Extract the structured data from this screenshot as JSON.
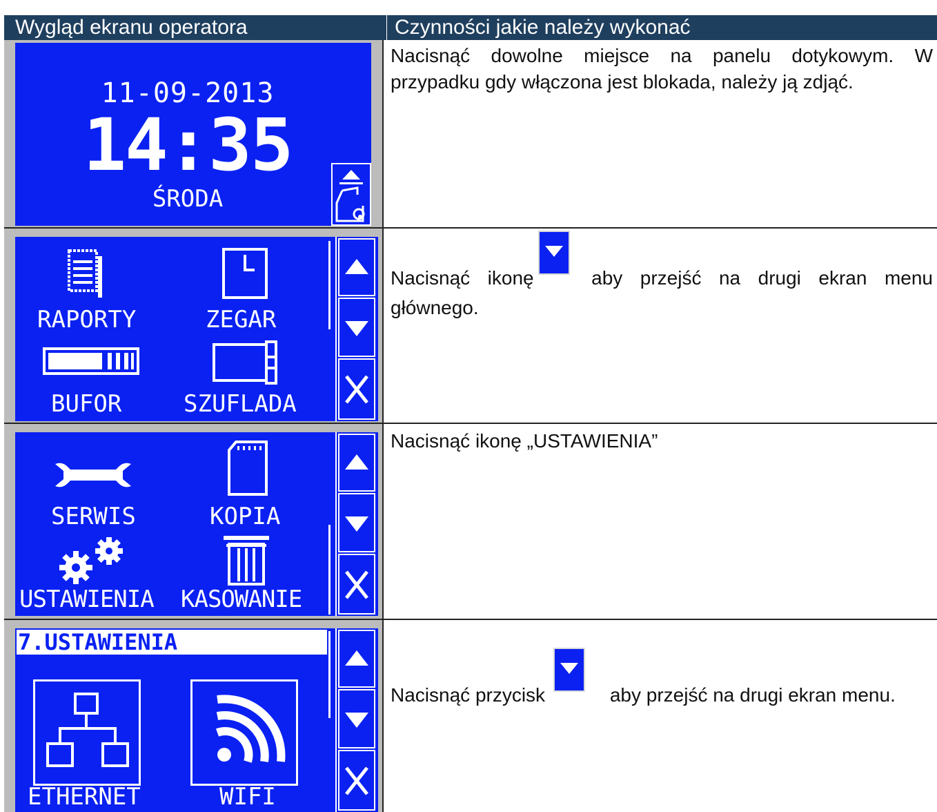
{
  "header": {
    "col1": "Wygląd ekranu operatora",
    "col2": "Czynności jakie należy wykonać"
  },
  "row1": {
    "date": "11-09-2013",
    "time": "14:35",
    "day": "ŚRODA",
    "instruction": "Nacisnąć dowolne miejsce na panelu dotykowym. W przypadku gdy włączona jest blokada, należy ją zdjąć."
  },
  "row2": {
    "items": [
      "RAPORTY",
      "ZEGAR",
      "BUFOR",
      "SZUFLADA"
    ],
    "instruction_a": "Nacisnąć ikonę",
    "instruction_b": "aby przejść na drugi ekran menu głównego."
  },
  "row3": {
    "items": [
      "SERWIS",
      "KOPIA",
      "USTAWIENIA",
      "KASOWANIE"
    ],
    "instruction": "Nacisnąć ikonę „USTAWIENIA”"
  },
  "row4": {
    "title": "7.USTAWIENIA",
    "items": [
      "ETHERNET",
      "WIFI"
    ],
    "instruction_a": "Nacisnąć przycisk",
    "instruction_b": "aby przejść na drugi ekran menu."
  },
  "colors": {
    "lcd_blue": "#0a21f2",
    "header_bg": "#1f3f5e",
    "frame_gray": "#bcbcbc"
  }
}
